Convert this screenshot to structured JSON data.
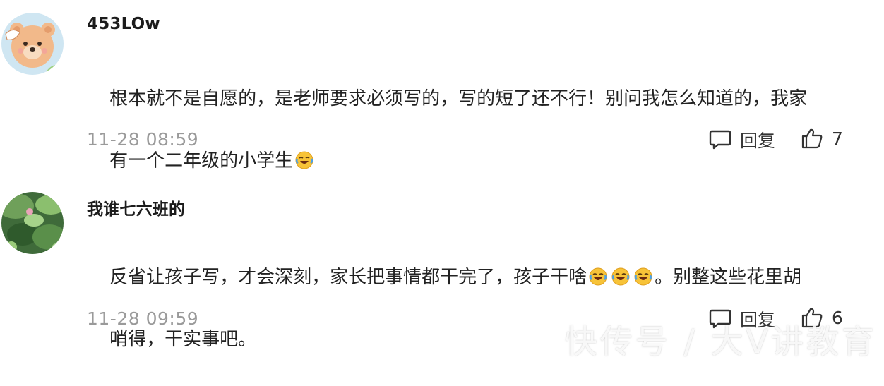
{
  "comments": [
    {
      "username": "453LOw",
      "text_line1": "根本就不是自愿的，是老师要求必须写的，写的短了还不行！别问我怎么知道的，我家",
      "text_line2": "有一个二年级的小学生",
      "emoji_count": 1,
      "timestamp": "11-28 08:59",
      "reply_label": "回复",
      "like_count": "7",
      "avatar_icon": "bear-avatar-icon"
    },
    {
      "username": "我谁七六班的",
      "text_line1_a": "反省让孩子写，才会深刻，家长把事情都干完了，孩子干啥",
      "text_line1_b": "。别整这些花里胡",
      "text_line2": "哨得，干实事吧。",
      "emoji_count": 3,
      "timestamp": "11-28 09:59",
      "reply_label": "回复",
      "like_count": "6",
      "avatar_icon": "lotus-pond-avatar-icon"
    }
  ],
  "watermark": "快传号 / 大V讲教育",
  "colors": {
    "text": "#222222",
    "username": "#1c1c1c",
    "timestamp": "#9a9a9a",
    "emoji_face": "#f7c338"
  }
}
